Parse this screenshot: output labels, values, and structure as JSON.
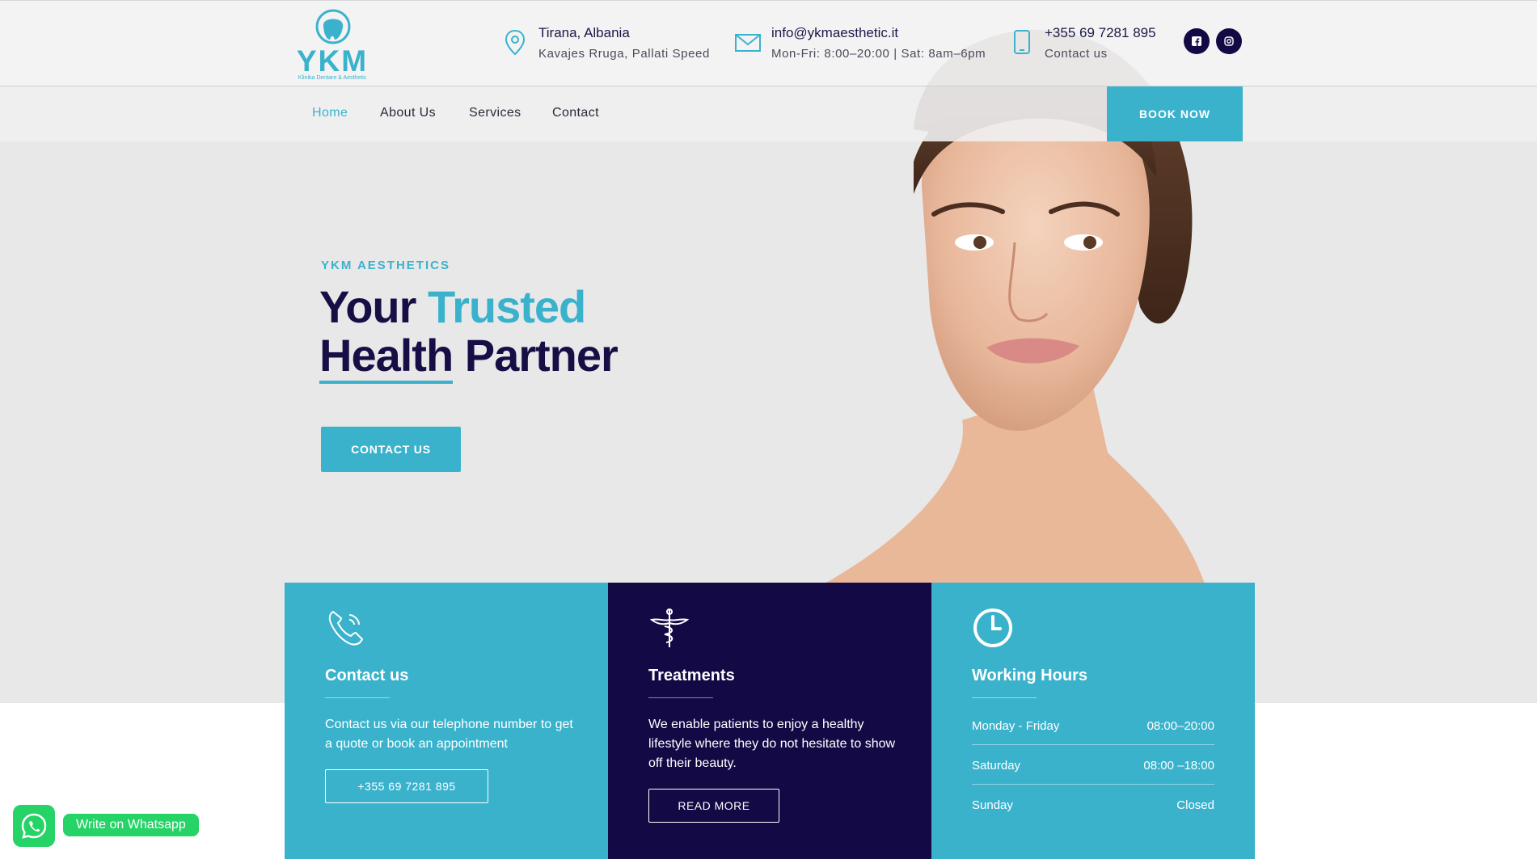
{
  "header": {
    "logo": {
      "text": "YKM",
      "subtitle": "Klinika Dentare & Aesthetic"
    },
    "location": {
      "title": "Tirana, Albania",
      "subtitle": "Kavajes Rruga, Pallati Speed"
    },
    "email": {
      "title": "info@ykmaesthetic.it",
      "subtitle": "Mon-Fri: 8:00–20:00 | Sat: 8am–6pm"
    },
    "phone": {
      "title": "+355 69 7281 895",
      "subtitle": "Contact us"
    },
    "social": [
      {
        "icon": "facebook-icon"
      },
      {
        "icon": "instagram-icon"
      }
    ]
  },
  "nav": {
    "items": [
      {
        "label": "Home",
        "active": true
      },
      {
        "label": "About Us"
      },
      {
        "label": "Services"
      },
      {
        "label": "Contact"
      }
    ],
    "book_label": "BOOK NOW"
  },
  "hero": {
    "eyebrow": "YKM AESTHETICS",
    "headline_part1": "Your",
    "headline_accent": "Trusted",
    "headline_underlined": "Health",
    "headline_part3": "Partner",
    "cta_label": "CONTACT US"
  },
  "cards": {
    "contact": {
      "icon": "phone-icon",
      "title": "Contact us",
      "text": "Contact us via our telephone number to get a quote or book an appointment",
      "button": "+355 69 7281 895"
    },
    "treatments": {
      "icon": "caduceus-icon",
      "title": "Treatments",
      "text": "We enable patients to enjoy a healthy lifestyle where they do not hesitate to show off their beauty.",
      "button": "READ MORE"
    },
    "hours": {
      "icon": "clock-icon",
      "title": "Working Hours",
      "rows": [
        {
          "day": "Monday - Friday",
          "hours": "08:00–20:00"
        },
        {
          "day": "Saturday",
          "hours": "08:00 –18:00"
        },
        {
          "day": "Sunday",
          "hours": "Closed"
        }
      ]
    }
  },
  "whatsapp": {
    "label": "Write on Whatsapp"
  },
  "colors": {
    "accent": "#3ab2cc",
    "navy": "#130a45",
    "whatsapp": "#25d366",
    "hero_bg": "#e8e8e9"
  }
}
